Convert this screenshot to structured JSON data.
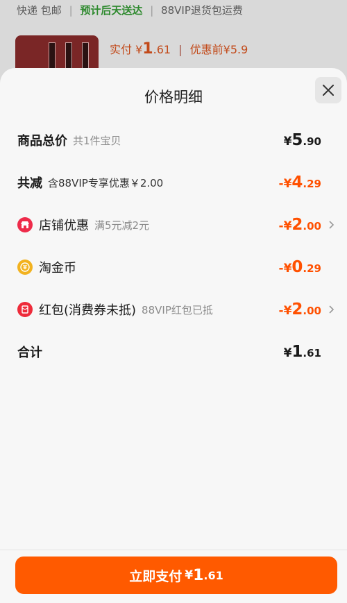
{
  "background": {
    "shipping": "快递 包邮",
    "delivery_estimate": "预计后天送达",
    "return_policy": "88VIP退货包运费",
    "price_label": "实付",
    "price_symbol": "¥",
    "price_int": "1",
    "price_dec": ".61",
    "original_label": "优惠前",
    "original_price": "¥5.9"
  },
  "sheet": {
    "title": "价格明细",
    "close_icon": "close-icon"
  },
  "rows": {
    "subtotal": {
      "label": "商品总价",
      "sub": "共1件宝贝",
      "symbol": "¥",
      "int": "5",
      "dec": ".90"
    },
    "total_discount": {
      "label": "共减",
      "sub": "含88VIP专享优惠￥2.00",
      "symbol": "-¥",
      "int": "4",
      "dec": ".29"
    },
    "store_discount": {
      "icon": "store-icon",
      "label": "店铺优惠",
      "sub": "满5元减2元",
      "symbol": "-¥",
      "int": "2",
      "dec": ".00"
    },
    "taojinbi": {
      "icon": "coin-icon",
      "label": "淘金币",
      "symbol": "-¥",
      "int": "0",
      "dec": ".29"
    },
    "red_packet": {
      "icon": "red-packet-icon",
      "label": "红包(消费券未抵)",
      "sub": "88VIP红包已抵",
      "symbol": "-¥",
      "int": "2",
      "dec": ".00"
    },
    "total": {
      "label": "合计",
      "symbol": "¥",
      "int": "1",
      "dec": ".61"
    }
  },
  "pay_button": {
    "label": "立即支付",
    "symbol": "¥",
    "int": "1",
    "dec": ".61"
  },
  "colors": {
    "accent": "#ff5000",
    "button": "#ff5a00",
    "green": "#2f8a2f"
  }
}
